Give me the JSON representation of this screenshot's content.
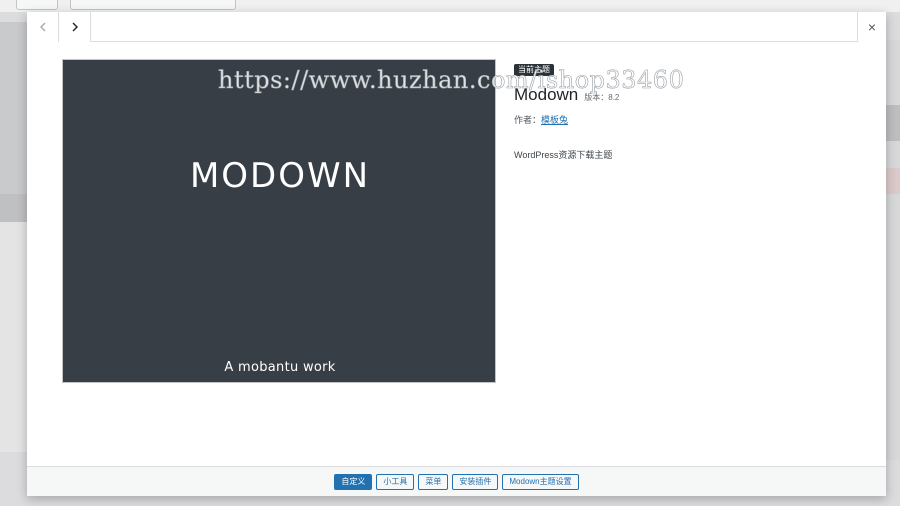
{
  "modal": {
    "current_theme_badge": "当前主题",
    "theme_name": "Modown",
    "version": "版本：8.2",
    "author_label": "作者：",
    "author_name": "模板兔",
    "description": "WordPress资源下载主题",
    "close_glyph": "×"
  },
  "screenshot": {
    "title": "MODOWN",
    "subtitle": "A mobantu work",
    "background_color": "#383e46"
  },
  "footer": {
    "buttons": [
      {
        "label": "自定义",
        "primary": true
      },
      {
        "label": "小工具",
        "primary": false
      },
      {
        "label": "菜单",
        "primary": false
      },
      {
        "label": "安装插件",
        "primary": false
      },
      {
        "label": "Modown主题设置",
        "primary": false
      }
    ]
  },
  "watermark": "https://www.huzhan.com/ishop33460",
  "colors": {
    "accent": "#2271b1",
    "badge": "#2c3338"
  },
  "icons": {
    "prev": "chevron-left-icon",
    "next": "chevron-right-icon",
    "close": "close-icon"
  }
}
